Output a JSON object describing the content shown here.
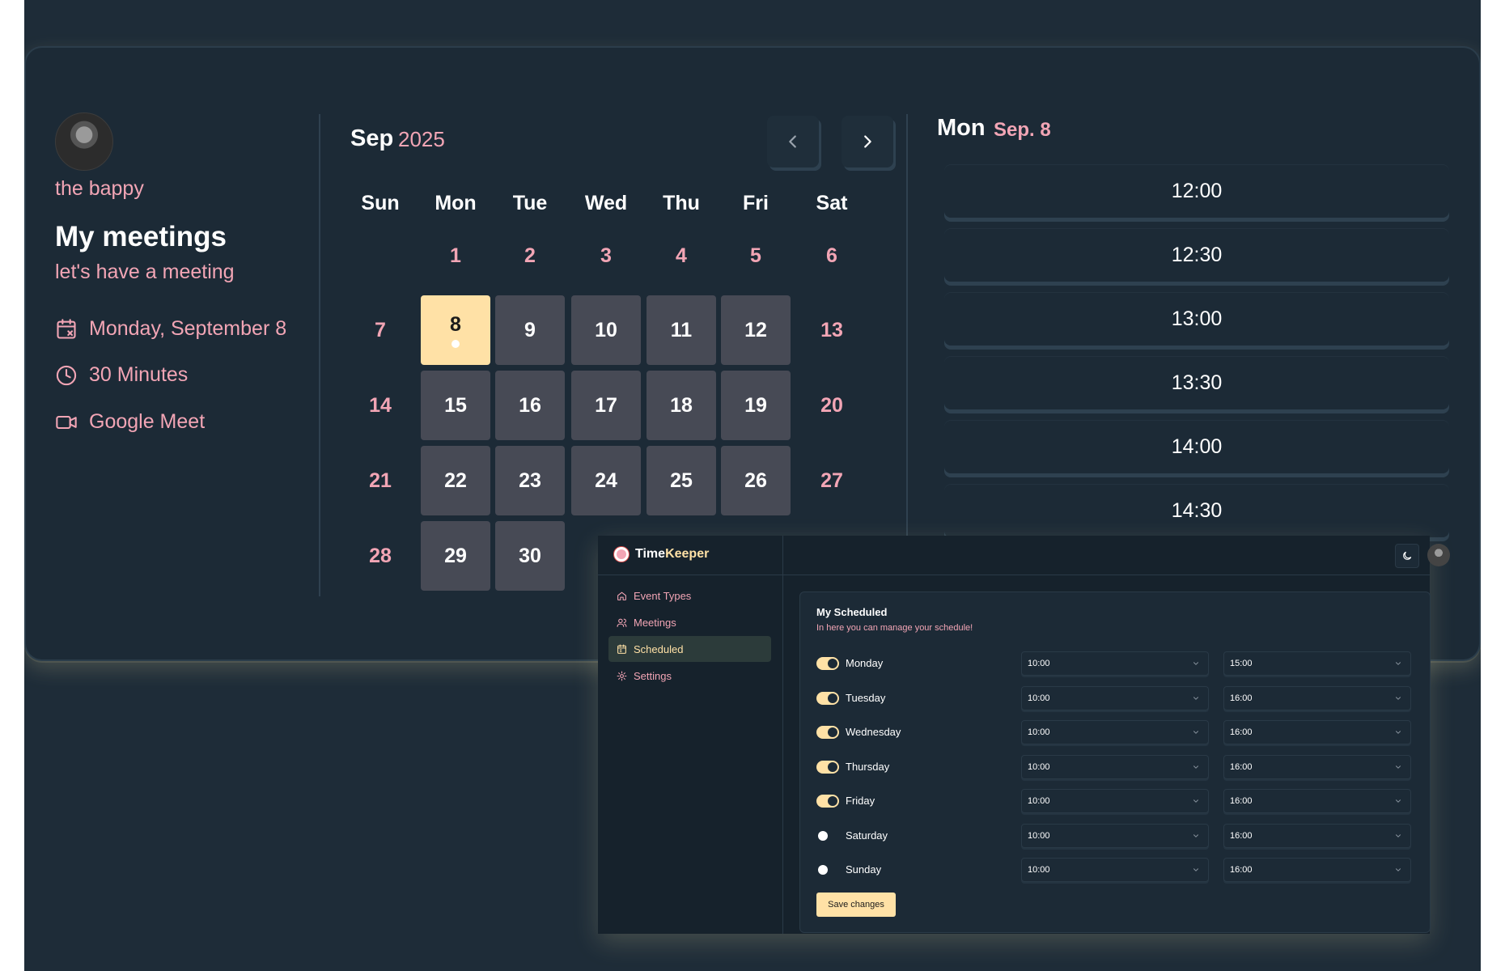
{
  "booking": {
    "host_name": "the bappy",
    "title": "My meetings",
    "subtitle": "let's have a meeting",
    "details": [
      {
        "icon": "calendar-x-icon",
        "text": "Monday, September 8"
      },
      {
        "icon": "clock-icon",
        "text": "30 Minutes"
      },
      {
        "icon": "video-icon",
        "text": "Google Meet"
      }
    ]
  },
  "calendar": {
    "month": "Sep",
    "year": "2025",
    "weekdays": [
      "Sun",
      "Mon",
      "Tue",
      "Wed",
      "Thu",
      "Fri",
      "Sat"
    ],
    "days": [
      {
        "n": "1",
        "state": "plain"
      },
      {
        "n": "2",
        "state": "plain"
      },
      {
        "n": "3",
        "state": "plain"
      },
      {
        "n": "4",
        "state": "plain"
      },
      {
        "n": "5",
        "state": "plain"
      },
      {
        "n": "6",
        "state": "plain"
      },
      {
        "n": "7",
        "state": "plain"
      },
      {
        "n": "8",
        "state": "selected"
      },
      {
        "n": "9",
        "state": "available"
      },
      {
        "n": "10",
        "state": "available"
      },
      {
        "n": "11",
        "state": "available"
      },
      {
        "n": "12",
        "state": "available"
      },
      {
        "n": "13",
        "state": "plain"
      },
      {
        "n": "14",
        "state": "plain"
      },
      {
        "n": "15",
        "state": "available"
      },
      {
        "n": "16",
        "state": "available"
      },
      {
        "n": "17",
        "state": "available"
      },
      {
        "n": "18",
        "state": "available"
      },
      {
        "n": "19",
        "state": "available"
      },
      {
        "n": "20",
        "state": "plain"
      },
      {
        "n": "21",
        "state": "plain"
      },
      {
        "n": "22",
        "state": "available"
      },
      {
        "n": "23",
        "state": "available"
      },
      {
        "n": "24",
        "state": "available"
      },
      {
        "n": "25",
        "state": "available"
      },
      {
        "n": "26",
        "state": "available"
      },
      {
        "n": "27",
        "state": "plain"
      },
      {
        "n": "28",
        "state": "plain"
      },
      {
        "n": "29",
        "state": "available"
      },
      {
        "n": "30",
        "state": "available"
      }
    ],
    "first_weekday": 1,
    "prev_icon": "chevron-left-icon",
    "next_icon": "chevron-right-icon"
  },
  "slots": {
    "day_label": "Mon",
    "date_label": "Sep. 8",
    "times": [
      "12:00",
      "12:30",
      "13:00",
      "13:30",
      "14:00",
      "14:30"
    ]
  },
  "app": {
    "brand_prefix": "Time",
    "brand_accent": "Keeper",
    "nav": [
      {
        "icon": "home-icon",
        "label": "Event Types",
        "active": false
      },
      {
        "icon": "users-icon",
        "label": "Meetings",
        "active": false
      },
      {
        "icon": "calendar-icon",
        "label": "Scheduled",
        "active": true
      },
      {
        "icon": "gear-icon",
        "label": "Settings",
        "active": false
      }
    ],
    "theme_icon": "moon-icon",
    "schedule": {
      "title": "My Scheduled",
      "subtitle": "In here you can manage your schedule!",
      "rows": [
        {
          "day": "Monday",
          "enabled": true,
          "from": "10:00",
          "to": "15:00"
        },
        {
          "day": "Tuesday",
          "enabled": true,
          "from": "10:00",
          "to": "16:00"
        },
        {
          "day": "Wednesday",
          "enabled": true,
          "from": "10:00",
          "to": "16:00"
        },
        {
          "day": "Thursday",
          "enabled": true,
          "from": "10:00",
          "to": "16:00"
        },
        {
          "day": "Friday",
          "enabled": true,
          "from": "10:00",
          "to": "16:00"
        },
        {
          "day": "Saturday",
          "enabled": false,
          "from": "10:00",
          "to": "16:00"
        },
        {
          "day": "Sunday",
          "enabled": false,
          "from": "10:00",
          "to": "16:00"
        }
      ],
      "save_label": "Save changes"
    }
  },
  "colors": {
    "background": "#1e2c38",
    "accent_pink": "#f2a5b5",
    "accent_yellow": "#ffe1a6",
    "day_tile": "#474a55"
  }
}
